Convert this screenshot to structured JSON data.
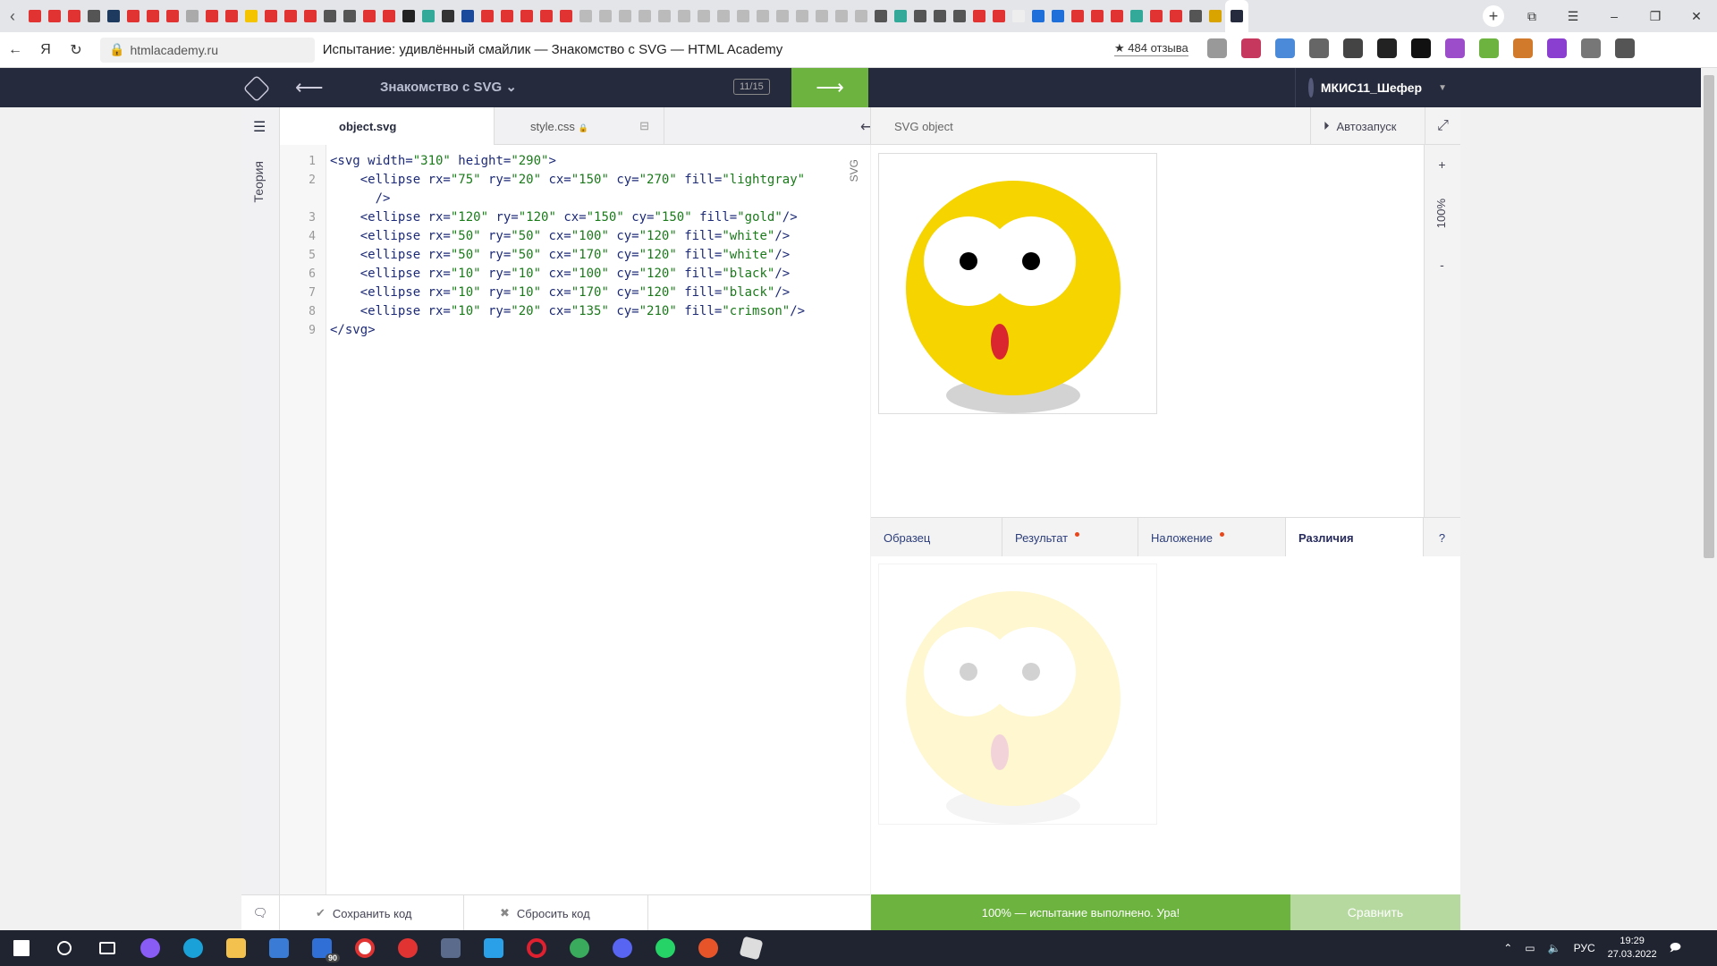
{
  "browser": {
    "url": "htmlacademy.ru",
    "title": "Испытание: удивлённый смайлик — Знакомство с SVG — HTML Academy",
    "reviews": "★ 484 отзыва"
  },
  "app": {
    "course_title": "Знакомство с SVG",
    "progress": "11/15",
    "next_arrow": "⟶",
    "back_arrow": "⟵",
    "user_name": "МКИС11_Шефер"
  },
  "sidebar": {
    "theory_label": "Теория"
  },
  "editor": {
    "tabs": [
      {
        "label": "object.svg"
      },
      {
        "label": "style.css"
      }
    ],
    "lang_label": "SVG",
    "line_numbers": [
      "1",
      "2",
      "",
      "3",
      "4",
      "5",
      "6",
      "7",
      "8",
      "9"
    ],
    "lines": [
      "<svg width=\"310\" height=\"290\">",
      "    <ellipse rx=\"75\" ry=\"20\" cx=\"150\" cy=\"270\" fill=\"lightgray\"",
      "      />",
      "    <ellipse rx=\"120\" ry=\"120\" cx=\"150\" cy=\"150\" fill=\"gold\"/>",
      "    <ellipse rx=\"50\" ry=\"50\" cx=\"100\" cy=\"120\" fill=\"white\"/>",
      "    <ellipse rx=\"50\" ry=\"50\" cx=\"170\" cy=\"120\" fill=\"white\"/>",
      "    <ellipse rx=\"10\" ry=\"10\" cx=\"100\" cy=\"120\" fill=\"black\"/>",
      "    <ellipse rx=\"10\" ry=\"10\" cx=\"170\" cy=\"120\" fill=\"black\"/>",
      "    <ellipse rx=\"10\" ry=\"20\" cx=\"135\" cy=\"210\" fill=\"crimson\"/>",
      "</svg>"
    ],
    "save_label": "Сохранить код",
    "reset_label": "Сбросить код"
  },
  "preview": {
    "label": "SVG object",
    "autorun_label": "Автозапуск",
    "zoom_label": "100%",
    "zoom_in": "+",
    "zoom_out": "-"
  },
  "compare": {
    "tabs": [
      {
        "label": "Образец"
      },
      {
        "label": "Результат"
      },
      {
        "label": "Наложение"
      },
      {
        "label": "Различия"
      }
    ],
    "help": "?",
    "status": "100% — испытание выполнено. Ура!",
    "compare_button": "Сравнить"
  },
  "taskbar": {
    "lang": "РУС",
    "time": "19:29",
    "date": "27.03.2022",
    "mail_badge": "90"
  },
  "colors": {
    "accent_green": "#6cb33f",
    "header_dark": "#262a3d",
    "smiley_face": "#f5d400",
    "smiley_mouth": "#d9262f"
  }
}
